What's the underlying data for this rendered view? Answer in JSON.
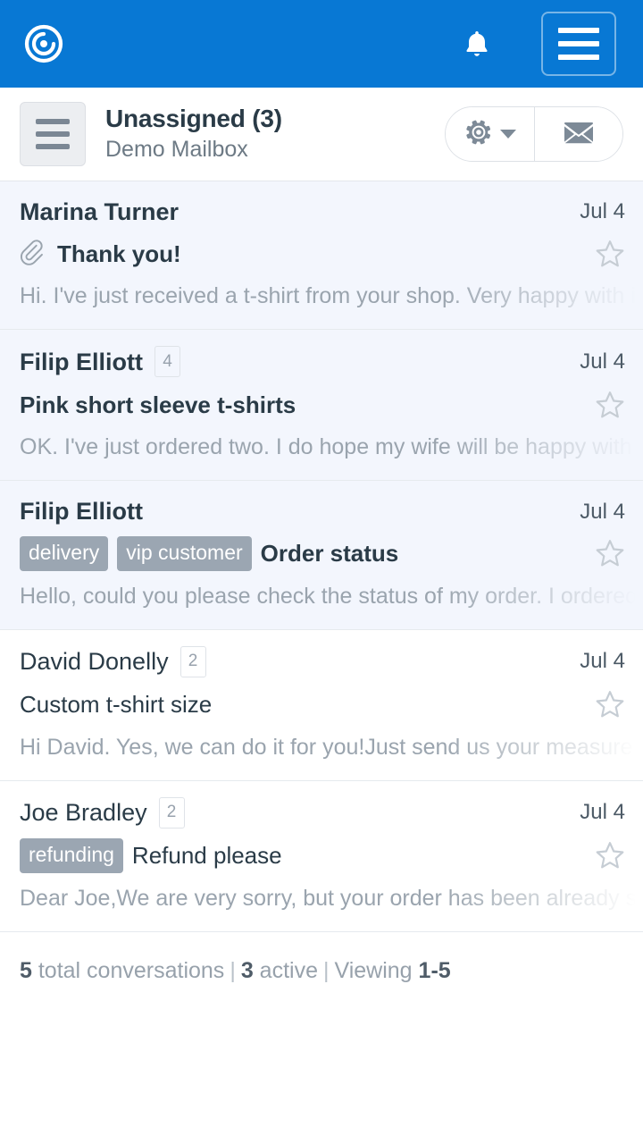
{
  "appbar": {
    "logo_icon": "helpscout-spiral-logo",
    "bell_icon": "bell-icon",
    "menu_icon": "hamburger-menu-icon",
    "background": "#0878d4"
  },
  "toolbar": {
    "folder_button_icon": "folders-hamburger-icon",
    "title": "Unassigned (3)",
    "mailbox": "Demo Mailbox",
    "gear_icon": "gear-icon",
    "caret_icon": "caret-down-icon",
    "mail_icon": "envelope-icon"
  },
  "conversations": [
    {
      "name": "Marina Turner",
      "count": "",
      "subject": "Thank you!",
      "tags": [],
      "attachment": true,
      "preview": "Hi. I've just received a t-shirt from your shop. Very happy with it!",
      "date": "Jul 4",
      "unread": true,
      "star_icon": "star-outline-icon"
    },
    {
      "name": "Filip Elliott",
      "count": "4",
      "subject": "Pink short sleeve t-shirts",
      "tags": [],
      "attachment": false,
      "preview": "OK. I've just ordered two. I do hope my wife will be happy with them.",
      "date": "Jul 4",
      "unread": true,
      "star_icon": "star-outline-icon"
    },
    {
      "name": "Filip Elliott",
      "count": "",
      "subject": "Order status",
      "tags": [
        "delivery",
        "vip customer"
      ],
      "attachment": false,
      "preview": "Hello, could you please check the status of my order. I ordered it last week.",
      "date": "Jul 4",
      "unread": true,
      "star_icon": "star-outline-icon"
    },
    {
      "name": "David Donelly",
      "count": "2",
      "subject": "Custom t-shirt size",
      "tags": [],
      "attachment": false,
      "preview": "Hi David. Yes, we can do it for you!Just send us your measurements.",
      "date": "Jul 4",
      "unread": false,
      "star_icon": "star-outline-icon"
    },
    {
      "name": "Joe Bradley",
      "count": "2",
      "subject": "Refund please",
      "tags": [
        "refunding"
      ],
      "attachment": false,
      "preview": "Dear Joe,We are very sorry, but your order has been already shipped.",
      "date": "Jul 4",
      "unread": false,
      "star_icon": "star-outline-icon"
    }
  ],
  "footer": {
    "total_count": "5",
    "total_label": "total conversations",
    "separator": "|",
    "active_count": "3",
    "active_label": "active",
    "viewing_label": "Viewing",
    "viewing_range": "1-5"
  }
}
